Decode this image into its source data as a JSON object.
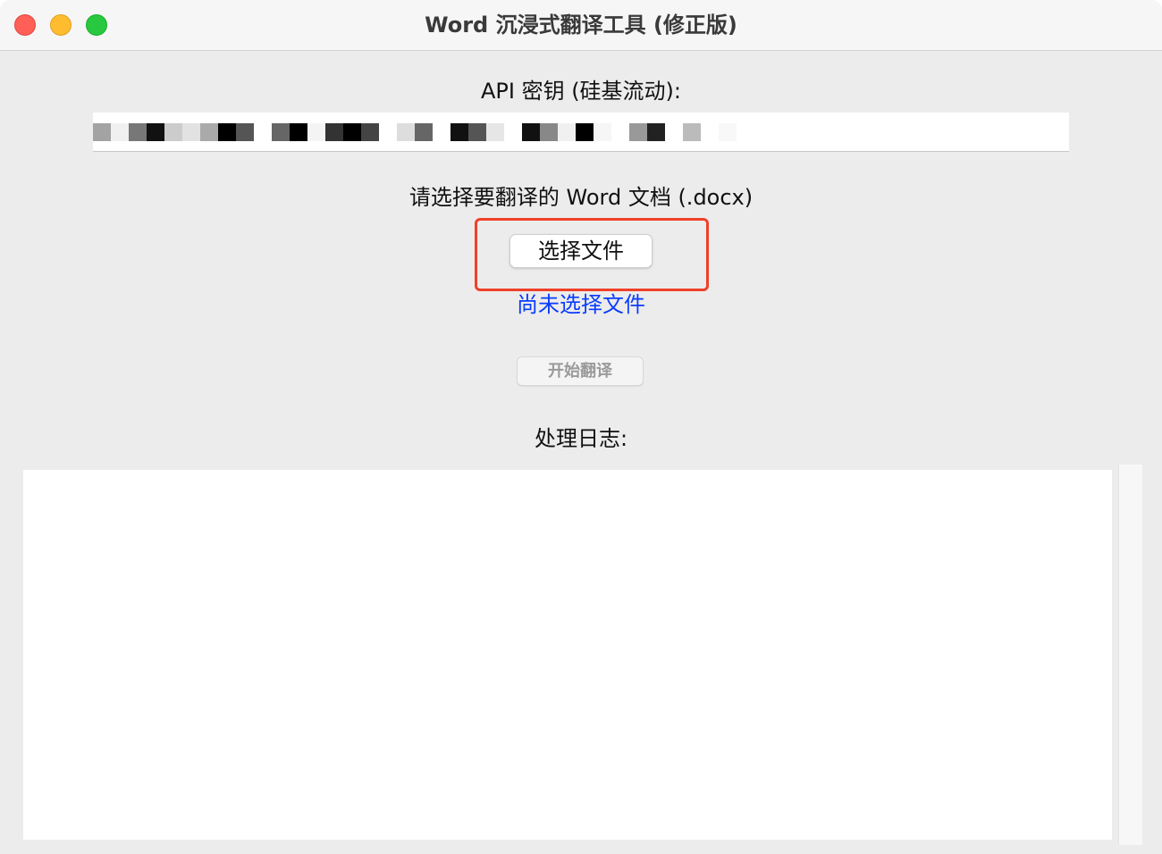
{
  "window": {
    "title": "Word 沉浸式翻译工具 (修正版)"
  },
  "api": {
    "label": "API 密钥 (硅基流动):",
    "value_redacted": true
  },
  "document": {
    "prompt": "请选择要翻译的 Word 文档 (.docx)",
    "choose_button_label": "选择文件",
    "status_text": "尚未选择文件"
  },
  "actions": {
    "start_button_label": "开始翻译",
    "start_button_enabled": false
  },
  "log": {
    "label": "处理日志:",
    "content": ""
  },
  "colors": {
    "highlight_border": "#f0402a",
    "status_link": "#0a3cff",
    "close": "#fe5f57",
    "minimize": "#febc2e",
    "zoom": "#28c840"
  }
}
